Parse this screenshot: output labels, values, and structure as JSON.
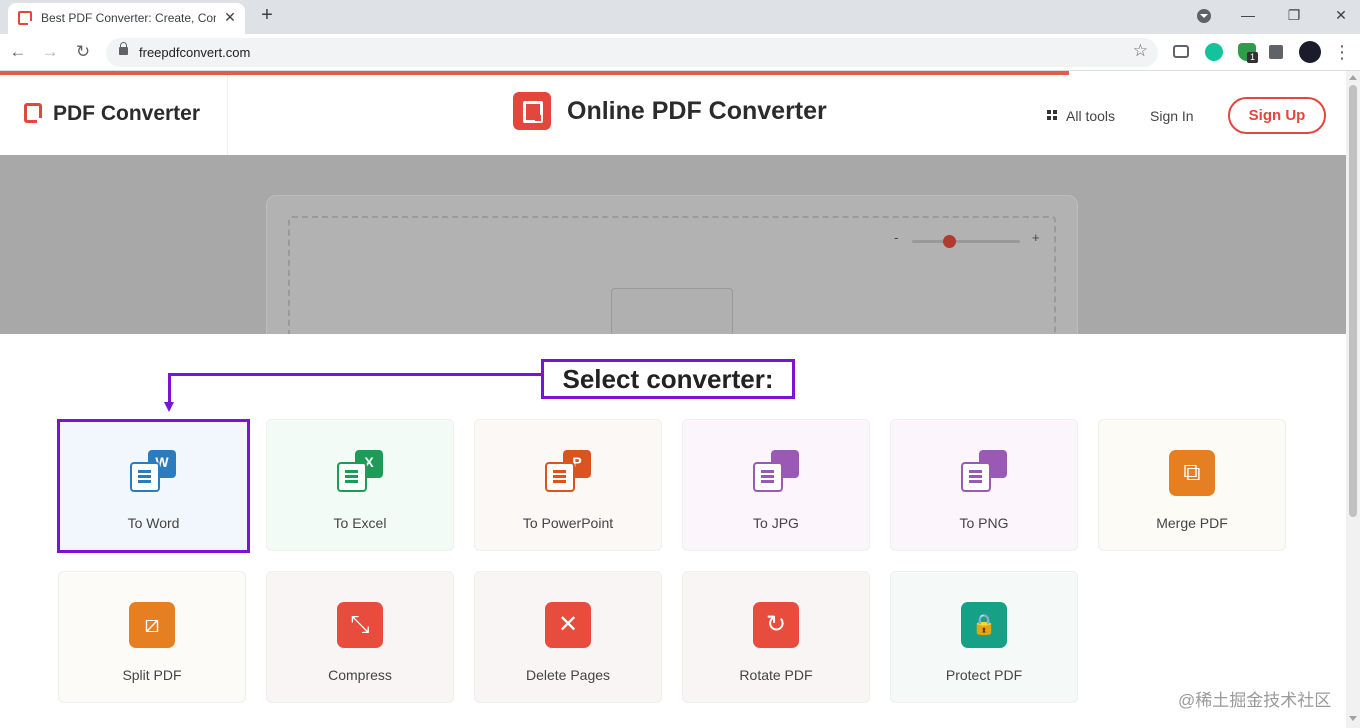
{
  "browser": {
    "tab_title": "Best PDF Converter: Create, Conv",
    "tab_close": "✕",
    "new_tab": "+",
    "url": "freepdfconvert.com",
    "back": "←",
    "forward": "→",
    "reload": "↻",
    "star": "☆",
    "minimize": "—",
    "restore": "❐",
    "close": "✕",
    "menu": "⋮",
    "extension_badge": "1"
  },
  "header": {
    "logo_text": "PDF Converter",
    "center_title": "Online PDF Converter",
    "all_tools": "All tools",
    "sign_in": "Sign In",
    "sign_up": "Sign Up"
  },
  "uploader": {
    "zoom_minus": "-",
    "zoom_plus": "+"
  },
  "annotation": {
    "select_label": "Select converter:"
  },
  "tools": [
    {
      "label": "To Word",
      "color": "#2b7bbd",
      "badge": "W",
      "icon": "word-file-icon"
    },
    {
      "label": "To Excel",
      "color": "#1f9b58",
      "badge": "X",
      "icon": "excel-file-icon"
    },
    {
      "label": "To PowerPoint",
      "color": "#d9541e",
      "badge": "P",
      "icon": "powerpoint-file-icon"
    },
    {
      "label": "To JPG",
      "color": "#9a59b5",
      "badge": "",
      "icon": "image-file-icon"
    },
    {
      "label": "To PNG",
      "color": "#9a59b5",
      "badge": "",
      "icon": "image-file-icon"
    },
    {
      "label": "Merge PDF",
      "color": "#e67e22",
      "glyph": "⧉",
      "icon": "merge-icon"
    },
    {
      "label": "Split PDF",
      "color": "#e67e22",
      "glyph": "⧄",
      "icon": "split-icon"
    },
    {
      "label": "Compress",
      "color": "#e74c3c",
      "glyph": "⤡",
      "icon": "compress-icon"
    },
    {
      "label": "Delete Pages",
      "color": "#e74c3c",
      "glyph": "✕",
      "icon": "delete-icon"
    },
    {
      "label": "Rotate PDF",
      "color": "#e74c3c",
      "glyph": "↻",
      "icon": "rotate-icon"
    },
    {
      "label": "Protect PDF",
      "color": "#16a085",
      "glyph": "🔒",
      "icon": "lock-icon"
    }
  ],
  "watermark": "@稀土掘金技术社区"
}
